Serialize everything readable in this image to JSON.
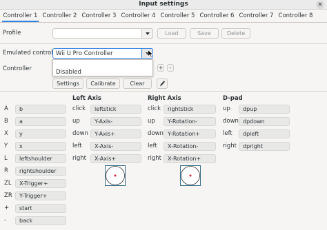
{
  "window": {
    "title": "Input settings",
    "close_icon": "×"
  },
  "tabs": [
    "Controller 1",
    "Controller 2",
    "Controller 3",
    "Controller 4",
    "Controller 5",
    "Controller 6",
    "Controller 7",
    "Controller 8"
  ],
  "profile": {
    "label": "Profile",
    "value": "",
    "load": "Load",
    "save": "Save",
    "delete": "Delete"
  },
  "emulated": {
    "label": "Emulated controller",
    "value": "Wii U Pro Controller",
    "dropdown_option": "Disabled"
  },
  "controller": {
    "label": "Controller",
    "add": "+",
    "remove": "-",
    "settings": "Settings",
    "calibrate": "Calibrate",
    "clear": "Clear"
  },
  "buttons": [
    {
      "key": "A",
      "value": "b"
    },
    {
      "key": "B",
      "value": "a"
    },
    {
      "key": "X",
      "value": "y"
    },
    {
      "key": "Y",
      "value": "x"
    },
    {
      "key": "L",
      "value": "leftshoulder"
    },
    {
      "key": "R",
      "value": "rightshoulder"
    },
    {
      "key": "ZL",
      "value": "X-Trigger+"
    },
    {
      "key": "ZR",
      "value": "Y-Trigger+"
    },
    {
      "key": "+",
      "value": "start"
    },
    {
      "key": "-",
      "value": "back"
    }
  ],
  "left_axis": {
    "title": "Left Axis",
    "rows": [
      {
        "key": "click",
        "value": "leftstick"
      },
      {
        "key": "up",
        "value": "Y-Axis-"
      },
      {
        "key": "down",
        "value": "Y-Axis+"
      },
      {
        "key": "left",
        "value": "X-Axis-"
      },
      {
        "key": "right",
        "value": "X-Axis+"
      }
    ]
  },
  "right_axis": {
    "title": "Right Axis",
    "rows": [
      {
        "key": "click",
        "value": "rightstick"
      },
      {
        "key": "up",
        "value": "Y-Rotation-"
      },
      {
        "key": "down",
        "value": "Y-Rotation+"
      },
      {
        "key": "left",
        "value": "X-Rotation-"
      },
      {
        "key": "right",
        "value": "X-Rotation+"
      }
    ]
  },
  "dpad": {
    "title": "D-pad",
    "rows": [
      {
        "key": "up",
        "value": "dpup"
      },
      {
        "key": "down",
        "value": "dpdown"
      },
      {
        "key": "left",
        "value": "dpleft"
      },
      {
        "key": "right",
        "value": "dpright"
      }
    ]
  },
  "icons": {
    "dropdown": "chevron-down-icon",
    "cursor": "mouse-cursor-icon",
    "edit": "pen-icon",
    "stick": "stick-position-icon"
  },
  "colors": {
    "accent": "#3584e4",
    "stick_dot": "#e01b24",
    "stick_frame": "#3a6f8f"
  }
}
